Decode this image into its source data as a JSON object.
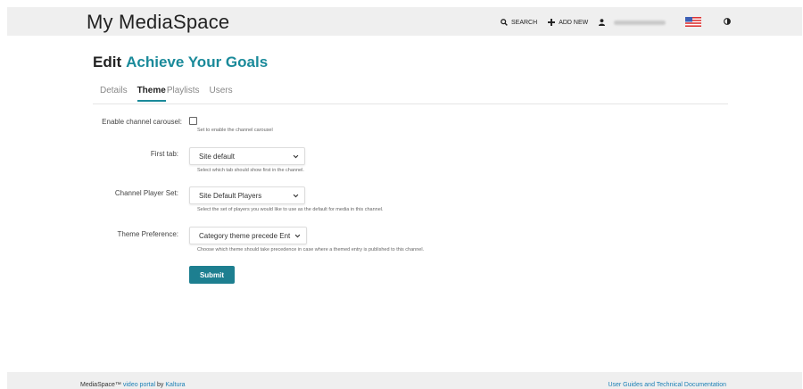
{
  "header": {
    "app_title": "My MediaSpace",
    "search_label": "SEARCH",
    "add_new_label": "ADD NEW",
    "icons": [
      "search-icon",
      "plus-icon",
      "user-icon",
      "us-flag-icon",
      "contrast-icon"
    ]
  },
  "page": {
    "title_prefix": "Edit",
    "channel_name": "Achieve Your Goals"
  },
  "tabs": [
    {
      "label": "Details",
      "active": false
    },
    {
      "label": "Theme",
      "active": true
    },
    {
      "label": "Playlists",
      "active": false
    },
    {
      "label": "Users",
      "active": false
    }
  ],
  "form": {
    "carousel": {
      "label": "Enable channel carousel:",
      "checked": false,
      "help": "Set to enable the channel carousel"
    },
    "first_tab": {
      "label": "First tab:",
      "value": "Site default",
      "help": "Select which tab should show first in the channel."
    },
    "player_set": {
      "label": "Channel Player Set:",
      "value": "Site Default Players",
      "help": "Select the set of players you would like to use as the default for media in this channel."
    },
    "theme_pref": {
      "label": "Theme Preference:",
      "value": "Category theme precede Ent",
      "help": "Choose which theme should take precedence in case where a themed entry is published to this channel."
    },
    "submit_label": "Submit"
  },
  "footer": {
    "brand": "MediaSpace™",
    "link_video_portal": "video portal",
    "by": "by",
    "link_kaltura": "Kaltura",
    "right_link": "User Guides and Technical Documentation"
  },
  "colors": {
    "accent": "#1a8a9a",
    "button": "#1d7f90",
    "link": "#1a7fb5",
    "bar_bg": "#efefef"
  }
}
